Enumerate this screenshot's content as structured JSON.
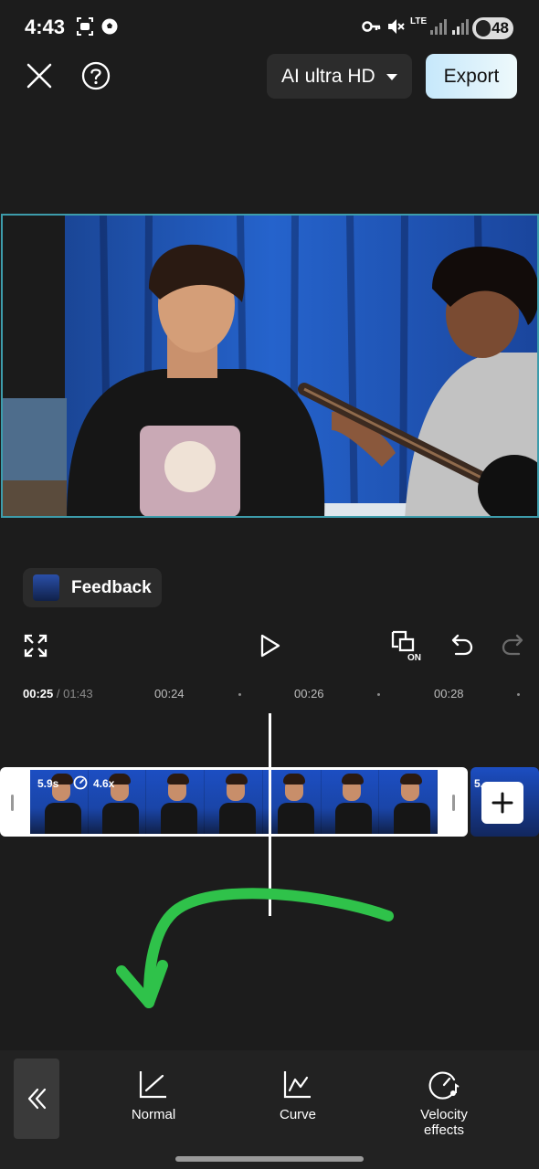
{
  "status_bar": {
    "time": "4:43",
    "network": "LTE",
    "battery": "48"
  },
  "top_bar": {
    "close_icon": "close-icon",
    "help_icon": "help-icon",
    "quality_label": "AI ultra HD",
    "export_label": "Export"
  },
  "feedback": {
    "label": "Feedback"
  },
  "timeline": {
    "current_time": "00:25",
    "total_time": "/ 01:43",
    "ticks": [
      "00:24",
      "00:26",
      "00:28"
    ],
    "clip": {
      "duration": "5.9s",
      "speed": "4.6x"
    },
    "next_clip_label": "5."
  },
  "bottom_toolbar": {
    "items": [
      {
        "label": "Normal",
        "icon": "normal-speed-icon"
      },
      {
        "label": "Curve",
        "icon": "curve-speed-icon"
      },
      {
        "label": "Velocity effects",
        "icon": "velocity-effects-icon"
      }
    ]
  },
  "colors": {
    "accent_border": "#3d9cab",
    "annotation_arrow": "#2fc24a",
    "export_gradient_start": "#c6e8fb"
  }
}
